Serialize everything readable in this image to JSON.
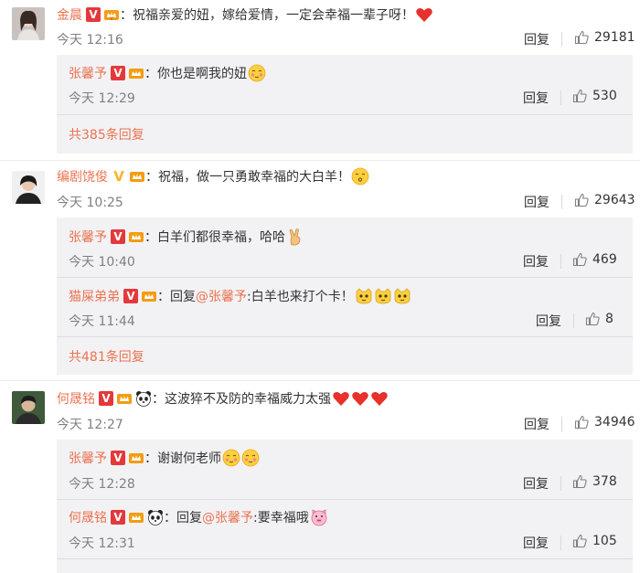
{
  "comments": [
    {
      "user": "金晨",
      "verified": "red",
      "text": "祝福亲爱的妞，嫁给爱情，一定会幸福一辈子呀！",
      "emoji": [
        "heart"
      ],
      "time": "今天 12:16",
      "reply_label": "回复",
      "likes": "29181",
      "replies": [
        {
          "user": "张馨予",
          "text": "你也是啊我的妞",
          "emoji": [
            "shy"
          ],
          "time": "今天 12:29",
          "reply_label": "回复",
          "likes": "530"
        }
      ],
      "more_replies": "共385条回复"
    },
    {
      "user": "编剧饶俊",
      "verified": "gold",
      "text": "祝福，做一只勇敢幸福的大白羊！",
      "emoji": [
        "kiss"
      ],
      "time": "今天 10:25",
      "reply_label": "回复",
      "likes": "29643",
      "replies": [
        {
          "user": "张馨予",
          "text": "白羊们都很幸福，哈哈",
          "emoji": [
            "victory"
          ],
          "time": "今天 10:40",
          "reply_label": "回复",
          "likes": "469"
        },
        {
          "user": "猫屎弟弟",
          "reply_prefix": "回复",
          "mention": "@张馨予",
          "text": ":白羊也来打个卡！",
          "emoji": [
            "cat",
            "cat",
            "cat"
          ],
          "time": "今天 11:44",
          "reply_label": "回复",
          "likes": "8"
        }
      ],
      "more_replies": "共481条回复"
    },
    {
      "user": "何晟铭",
      "verified": "red",
      "text": "这波猝不及防的幸福威力太强",
      "emoji": [
        "heart",
        "heart",
        "heart"
      ],
      "time": "今天 12:27",
      "reply_label": "回复",
      "likes": "34946",
      "replies": [
        {
          "user": "张馨予",
          "text": "谢谢何老师",
          "emoji": [
            "shy",
            "shy"
          ],
          "time": "今天 12:28",
          "reply_label": "回复",
          "likes": "378"
        },
        {
          "user": "何晟铭",
          "reply_prefix": "回复",
          "mention": "@张馨予",
          "text": ":要幸福哦",
          "emoji": [
            "pig"
          ],
          "time": "今天 12:31",
          "reply_label": "回复",
          "likes": "105"
        }
      ]
    }
  ],
  "colors": {
    "username": "#eb7350",
    "subbox_bg": "#f2f2f5",
    "verified_red": "#e4393c",
    "verified_gold": "#f7b52c",
    "time": "#808080"
  }
}
